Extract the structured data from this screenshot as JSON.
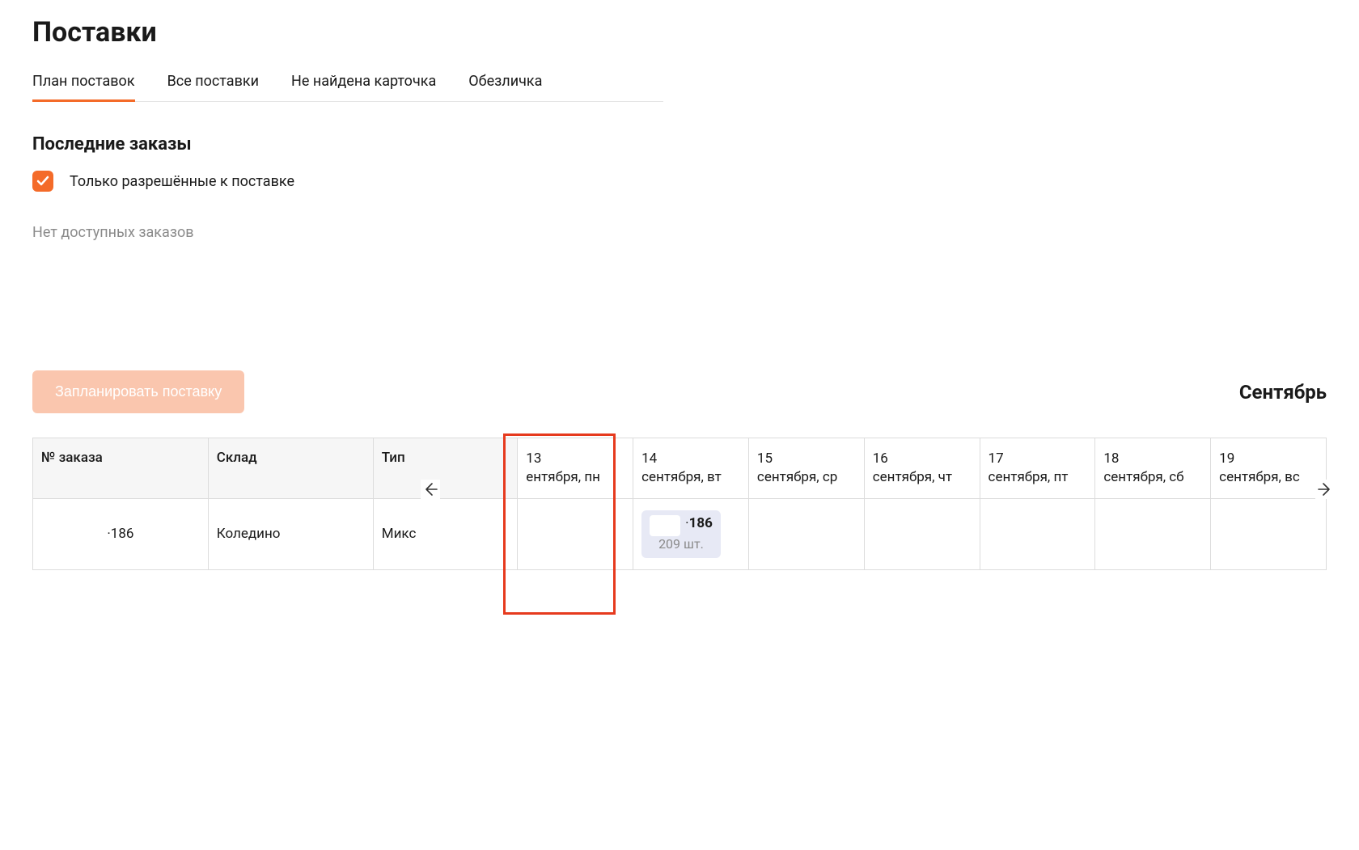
{
  "page_title": "Поставки",
  "tabs": [
    {
      "label": "План поставок",
      "active": true
    },
    {
      "label": "Все поставки",
      "active": false
    },
    {
      "label": "Не найдена карточка",
      "active": false
    },
    {
      "label": "Обезличка",
      "active": false
    }
  ],
  "recent": {
    "title": "Последние заказы",
    "checkbox_label": "Только разрешённые к поставке",
    "checkbox_checked": true,
    "empty": "Нет доступных заказов"
  },
  "plan_button": "Запланировать поставку",
  "month": "Сентябрь",
  "columns": {
    "order": "№ заказа",
    "sklad": "Склад",
    "type": "Тип"
  },
  "dates": [
    {
      "day": "13",
      "rest": "ентября, пн"
    },
    {
      "day": "14",
      "rest": "сентября, вт"
    },
    {
      "day": "15",
      "rest": "сентября, ср"
    },
    {
      "day": "16",
      "rest": "сентября, чт"
    },
    {
      "day": "17",
      "rest": "сентября, пт"
    },
    {
      "day": "18",
      "rest": "сентября, сб"
    },
    {
      "day": "19",
      "rest": "сентября, вс"
    }
  ],
  "row": {
    "order_suffix": "186",
    "sklad": "Коледино",
    "type": "Микс",
    "chip": {
      "num": "186",
      "qty": "209 шт."
    }
  }
}
